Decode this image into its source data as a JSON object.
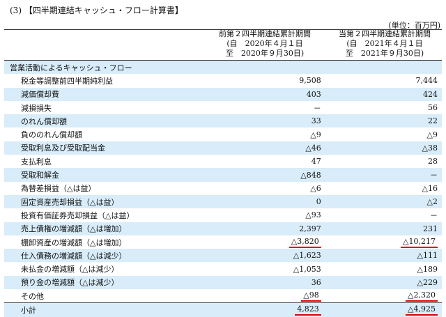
{
  "heading": "(3) 【四半期連結キャッシュ・フロー計算書】",
  "unit": "(単位：百万円)",
  "columns": {
    "prev": {
      "line1": "前第２四半期連結累計期間",
      "line2": "(自　2020年４月１日",
      "line3": "至　2020年９月30日)"
    },
    "curr": {
      "line1": "当第２四半期連結累計期間",
      "line2": "(自　2021年４月１日",
      "line3": "至　2021年９月30日)"
    }
  },
  "rows": [
    {
      "label": "営業活動によるキャッシュ・フロー",
      "prev": "",
      "curr": "",
      "section": true
    },
    {
      "label": "税金等調整前四半期純利益",
      "prev": "9,508",
      "curr": "7,444"
    },
    {
      "label": "減価償却費",
      "prev": "403",
      "curr": "424"
    },
    {
      "label": "減損損失",
      "prev": "－",
      "curr": "56"
    },
    {
      "label": "のれん償却額",
      "prev": "33",
      "curr": "22"
    },
    {
      "label": "負ののれん償却額",
      "prev": "△9",
      "curr": "△9"
    },
    {
      "label": "受取利息及び受取配当金",
      "prev": "△46",
      "curr": "△38"
    },
    {
      "label": "支払利息",
      "prev": "47",
      "curr": "28"
    },
    {
      "label": "受取和解金",
      "prev": "△848",
      "curr": "－"
    },
    {
      "label": "為替差損益（△は益）",
      "prev": "△6",
      "curr": "△16"
    },
    {
      "label": "固定資産売却損益（△は益）",
      "prev": "0",
      "curr": "△2"
    },
    {
      "label": "投資有価証券売却損益（△は益）",
      "prev": "△93",
      "curr": "－"
    },
    {
      "label": "売上債権の増減額（△は増加）",
      "prev": "2,397",
      "curr": "231"
    },
    {
      "label": "棚卸資産の増減額（△は増加）",
      "prev": "△3,820",
      "curr": "△10,217",
      "highlight": true
    },
    {
      "label": "仕入債務の増減額（△は減少）",
      "prev": "△1,623",
      "curr": "△111"
    },
    {
      "label": "未払金の増減額（△は減少）",
      "prev": "△1,053",
      "curr": "△189"
    },
    {
      "label": "預り金の増減額（△は減少）",
      "prev": "36",
      "curr": "△229"
    },
    {
      "label": "その他",
      "prev": "△98",
      "curr": "△2,320",
      "highlight": true
    },
    {
      "label": "小計",
      "prev": "4,823",
      "curr": "△4,925",
      "highlight": true,
      "total": true
    }
  ]
}
